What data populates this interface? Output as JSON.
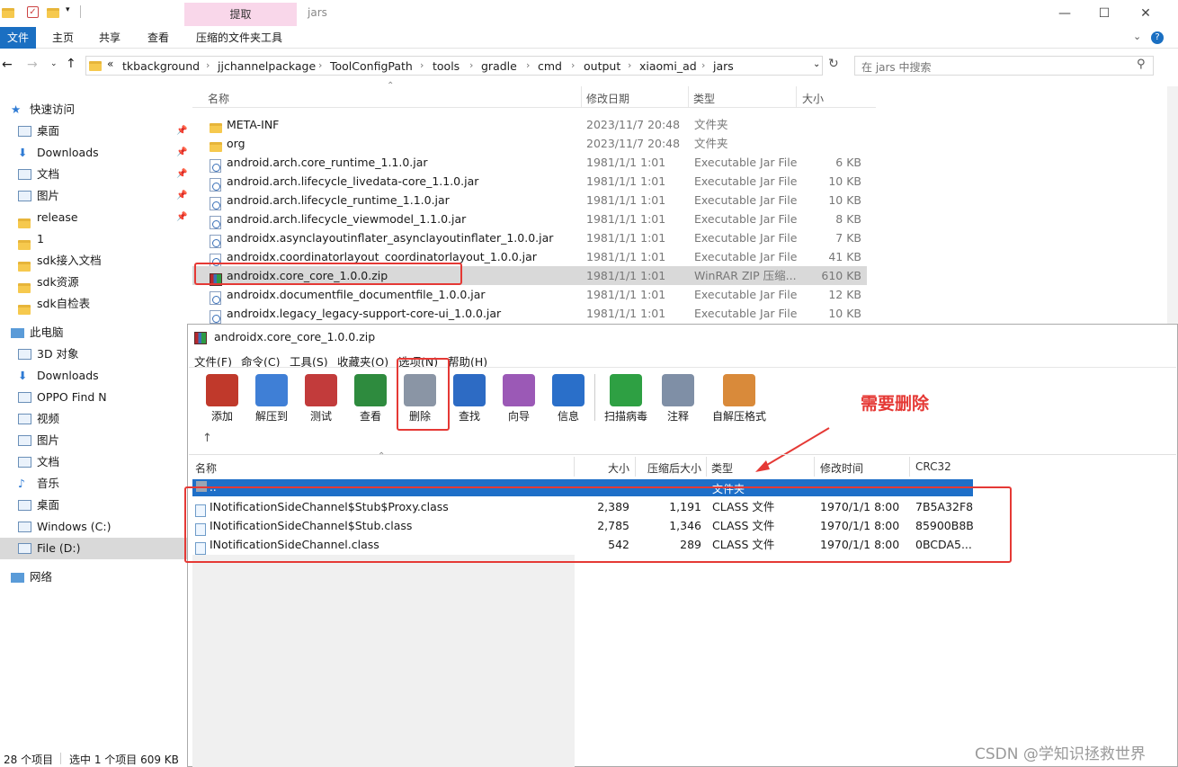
{
  "explorer": {
    "context_tab": "提取",
    "window_title": "jars",
    "ribbon_tabs": [
      "文件",
      "主页",
      "共享",
      "查看",
      "压缩的文件夹工具"
    ],
    "breadcrumb": [
      "tkbackground",
      "jjchannelpackage",
      "ToolConfigPath",
      "tools",
      "gradle",
      "cmd",
      "output",
      "xiaomi_ad",
      "jars"
    ],
    "search_placeholder": "在 jars 中搜索",
    "columns": [
      "名称",
      "修改日期",
      "类型",
      "大小"
    ],
    "nav": [
      {
        "label": "快速访问",
        "icon": "star-icon",
        "pinned": false
      },
      {
        "label": "桌面",
        "icon": "desktop-icon",
        "pinned": true
      },
      {
        "label": "Downloads",
        "icon": "download-icon",
        "pinned": true
      },
      {
        "label": "文档",
        "icon": "document-icon",
        "pinned": true
      },
      {
        "label": "图片",
        "icon": "picture-icon",
        "pinned": true
      },
      {
        "label": "release",
        "icon": "folder-check-icon",
        "pinned": true
      },
      {
        "label": "1",
        "icon": "folder-icon",
        "pinned": false
      },
      {
        "label": "sdk接入文档",
        "icon": "folder-icon",
        "pinned": false
      },
      {
        "label": "sdk资源",
        "icon": "folder-icon",
        "pinned": false
      },
      {
        "label": "sdk自检表",
        "icon": "folder-icon",
        "pinned": false
      },
      {
        "label": "此电脑",
        "icon": "computer-icon",
        "pinned": false
      },
      {
        "label": "3D 对象",
        "icon": "cube-icon",
        "pinned": false
      },
      {
        "label": "Downloads",
        "icon": "download-icon",
        "pinned": false
      },
      {
        "label": "OPPO Find N",
        "icon": "phone-icon",
        "pinned": false
      },
      {
        "label": "视频",
        "icon": "video-icon",
        "pinned": false
      },
      {
        "label": "图片",
        "icon": "picture-icon",
        "pinned": false
      },
      {
        "label": "文档",
        "icon": "document-icon",
        "pinned": false
      },
      {
        "label": "音乐",
        "icon": "music-icon",
        "pinned": false
      },
      {
        "label": "桌面",
        "icon": "desktop-icon",
        "pinned": false
      },
      {
        "label": "Windows (C:)",
        "icon": "drive-icon",
        "pinned": false
      },
      {
        "label": "File (D:)",
        "icon": "drive-icon",
        "pinned": false
      },
      {
        "label": "网络",
        "icon": "network-icon",
        "pinned": false
      }
    ],
    "files": [
      {
        "name": "META-INF",
        "date": "2023/11/7 20:48",
        "type": "文件夹",
        "size": "",
        "icon": "folder-icon"
      },
      {
        "name": "org",
        "date": "2023/11/7 20:48",
        "type": "文件夹",
        "size": "",
        "icon": "folder-icon"
      },
      {
        "name": "android.arch.core_runtime_1.1.0.jar",
        "date": "1981/1/1 1:01",
        "type": "Executable Jar File",
        "size": "6 KB",
        "icon": "jar-icon"
      },
      {
        "name": "android.arch.lifecycle_livedata-core_1.1.0.jar",
        "date": "1981/1/1 1:01",
        "type": "Executable Jar File",
        "size": "10 KB",
        "icon": "jar-icon"
      },
      {
        "name": "android.arch.lifecycle_runtime_1.1.0.jar",
        "date": "1981/1/1 1:01",
        "type": "Executable Jar File",
        "size": "10 KB",
        "icon": "jar-icon"
      },
      {
        "name": "android.arch.lifecycle_viewmodel_1.1.0.jar",
        "date": "1981/1/1 1:01",
        "type": "Executable Jar File",
        "size": "8 KB",
        "icon": "jar-icon"
      },
      {
        "name": "androidx.asynclayoutinflater_asynclayoutinflater_1.0.0.jar",
        "date": "1981/1/1 1:01",
        "type": "Executable Jar File",
        "size": "7 KB",
        "icon": "jar-icon"
      },
      {
        "name": "androidx.coordinatorlayout_coordinatorlayout_1.0.0.jar",
        "date": "1981/1/1 1:01",
        "type": "Executable Jar File",
        "size": "41 KB",
        "icon": "jar-icon"
      },
      {
        "name": "androidx.core_core_1.0.0.zip",
        "date": "1981/1/1 1:01",
        "type": "WinRAR ZIP 压缩...",
        "size": "610 KB",
        "icon": "winrar-icon",
        "selected": true
      },
      {
        "name": "androidx.documentfile_documentfile_1.0.0.jar",
        "date": "1981/1/1 1:01",
        "type": "Executable Jar File",
        "size": "12 KB",
        "icon": "jar-icon"
      },
      {
        "name": "androidx.legacy_legacy-support-core-ui_1.0.0.jar",
        "date": "1981/1/1 1:01",
        "type": "Executable Jar File",
        "size": "10 KB",
        "icon": "jar-icon"
      }
    ],
    "status": {
      "count": "28 个项目",
      "selected": "选中 1 个项目  609 KB"
    }
  },
  "winrar": {
    "title": "androidx.core_core_1.0.0.zip",
    "menu": [
      "文件(F)",
      "命令(C)",
      "工具(S)",
      "收藏夹(O)",
      "选项(N)",
      "帮助(H)"
    ],
    "tools": [
      {
        "label": "添加",
        "icon": "add-icon",
        "color": "#c0392b"
      },
      {
        "label": "解压到",
        "icon": "extract-icon",
        "color": "#3f7fd6"
      },
      {
        "label": "测试",
        "icon": "test-icon",
        "color": "#c23b3b"
      },
      {
        "label": "查看",
        "icon": "view-icon",
        "color": "#2e8b3e"
      },
      {
        "label": "删除",
        "icon": "delete-icon",
        "color": "#8a95a5"
      },
      {
        "label": "查找",
        "icon": "find-icon",
        "color": "#2d6bc4"
      },
      {
        "label": "向导",
        "icon": "wizard-icon",
        "color": "#9b59b6"
      },
      {
        "label": "信息",
        "icon": "info-icon",
        "color": "#2a6fc9"
      },
      {
        "label": "扫描病毒",
        "icon": "virus-scan-icon",
        "color": "#2ea043"
      },
      {
        "label": "注释",
        "icon": "comment-icon",
        "color": "#7f8fa6"
      },
      {
        "label": "自解压格式",
        "icon": "sfx-icon",
        "color": "#d98a3a"
      }
    ],
    "annotation": "需要删除",
    "up_button": "↑",
    "columns": [
      "名称",
      "大小",
      "压缩后大小",
      "类型",
      "修改时间",
      "CRC32"
    ],
    "parent_row": {
      "name": "..",
      "type": "文件夹"
    },
    "files": [
      {
        "name": "INotificationSideChannel$Stub$Proxy.class",
        "size": "2,389",
        "packed": "1,191",
        "type": "CLASS 文件",
        "modified": "1970/1/1 8:00",
        "crc": "7B5A32F8"
      },
      {
        "name": "INotificationSideChannel$Stub.class",
        "size": "2,785",
        "packed": "1,346",
        "type": "CLASS 文件",
        "modified": "1970/1/1 8:00",
        "crc": "85900B8B"
      },
      {
        "name": "INotificationSideChannel.class",
        "size": "542",
        "packed": "289",
        "type": "CLASS 文件",
        "modified": "1970/1/1 8:00",
        "crc": "0BCDA5..."
      }
    ]
  },
  "watermark": "CSDN @学知识拯救世界",
  "colors": {
    "accent": "#1a6fc2",
    "highlight": "#e53935",
    "selection": "#d9d9d9",
    "rar_selection": "#1e6fc8"
  }
}
